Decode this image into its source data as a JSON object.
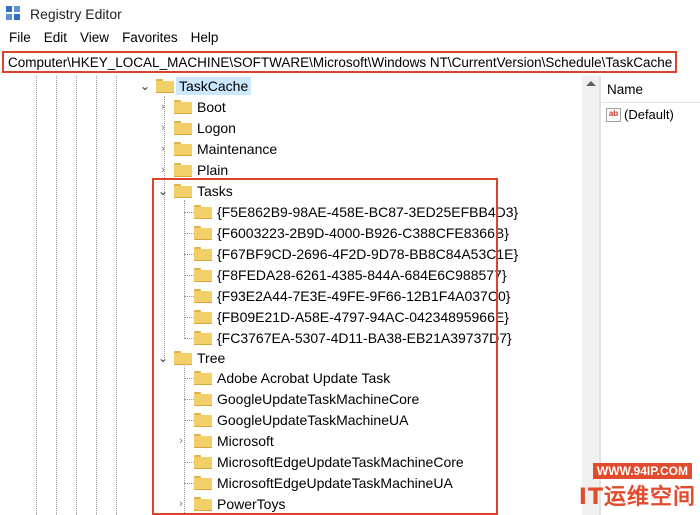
{
  "window": {
    "title": "Registry Editor"
  },
  "menu": [
    "File",
    "Edit",
    "View",
    "Favorites",
    "Help"
  ],
  "address": "Computer\\HKEY_LOCAL_MACHINE\\SOFTWARE\\Microsoft\\Windows NT\\CurrentVersion\\Schedule\\TaskCache",
  "tree": {
    "root": "TaskCache",
    "children": [
      "Boot",
      "Logon",
      "Maintenance",
      "Plain",
      "Tasks",
      "Tree"
    ],
    "tasks": [
      "{F5E862B9-98AE-458E-BC87-3ED25EFBB4D3}",
      "{F6003223-2B9D-4000-B926-C388CFE8366B}",
      "{F67BF9CD-2696-4F2D-9D78-BB8C84A53C1E}",
      "{F8FEDA28-6261-4385-844A-684E6C988577}",
      "{F93E2A44-7E3E-49FE-9F66-12B1F4A037C0}",
      "{FB09E21D-A58E-4797-94AC-04234895966E}",
      "{FC3767EA-5307-4D11-BA38-EB21A39737D7}"
    ],
    "tree_items": [
      "Adobe Acrobat Update Task",
      "GoogleUpdateTaskMachineCore",
      "GoogleUpdateTaskMachineUA",
      "Microsoft",
      "MicrosoftEdgeUpdateTaskMachineCore",
      "MicrosoftEdgeUpdateTaskMachineUA",
      "PowerToys"
    ]
  },
  "values_pane": {
    "column_name": "Name",
    "rows": [
      "(Default)"
    ],
    "icon": "string-value-icon",
    "icon_text": "ab"
  },
  "watermark": {
    "url": "WWW.94IP.COM",
    "brand": "IT运维空间"
  },
  "colors": {
    "highlight": "#d9442b",
    "selection": "#cce8ff",
    "folder": "#f3cf6a"
  }
}
